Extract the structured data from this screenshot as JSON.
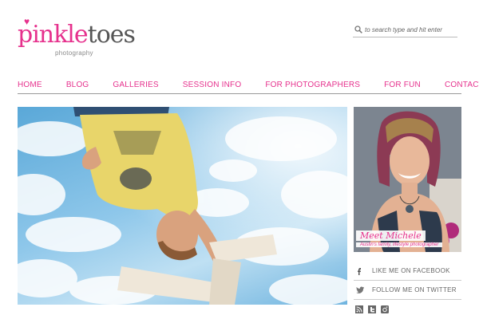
{
  "logo": {
    "main_pink": "pinkle",
    "main_rest": "toes",
    "sub": "photography"
  },
  "search": {
    "placeholder": "to search type and hit enter",
    "icon": "search-icon"
  },
  "nav": {
    "items": [
      {
        "label": "HOME"
      },
      {
        "label": "BLOG"
      },
      {
        "label": "GALLERIES"
      },
      {
        "label": "SESSION INFO"
      },
      {
        "label": "FOR PHOTOGRAPHERS"
      },
      {
        "label": "FOR FUN"
      },
      {
        "label": "CONTACT"
      }
    ]
  },
  "sidebar": {
    "meet_title": "Meet Michele",
    "meet_sub": "Austin's family, lifestyle photographer",
    "facebook_label": "LIKE ME ON FACEBOOK",
    "twitter_label": "FOLLOW ME ON TWITTER",
    "icons": [
      "rss-icon",
      "twitter-icon",
      "instagram-icon"
    ]
  },
  "colors": {
    "brand_pink": "#e6318d",
    "text_gray": "#555555"
  }
}
